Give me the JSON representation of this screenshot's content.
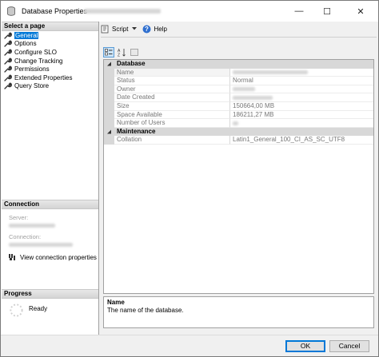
{
  "window": {
    "title": "Database Properties - ",
    "minimize": "—",
    "maximize": "☐",
    "close": "✕"
  },
  "left_pane": {
    "select_header": "Select a page",
    "pages": [
      "General",
      "Options",
      "Configure SLO",
      "Change Tracking",
      "Permissions",
      "Extended Properties",
      "Query Store"
    ],
    "connection_header": "Connection",
    "server_label": "Server:",
    "connection_label": "Connection:",
    "view_connection_link": "View connection properties",
    "progress_header": "Progress",
    "progress_status": "Ready"
  },
  "toolbar": {
    "script_label": "Script",
    "help_label": "Help"
  },
  "property_grid": {
    "categories": [
      {
        "name": "Database",
        "rows": [
          {
            "name": "Name",
            "value": ""
          },
          {
            "name": "Status",
            "value": "Normal"
          },
          {
            "name": "Owner",
            "value": ""
          },
          {
            "name": "Date Created",
            "value": ""
          },
          {
            "name": "Size",
            "value": "150664,00 MB"
          },
          {
            "name": "Space Available",
            "value": "186211,27 MB"
          },
          {
            "name": "Number of Users",
            "value": ""
          }
        ]
      },
      {
        "name": "Maintenance",
        "rows": [
          {
            "name": "Collation",
            "value": "Latin1_General_100_CI_AS_SC_UTF8"
          }
        ]
      }
    ]
  },
  "description": {
    "title": "Name",
    "text": "The name of the database."
  },
  "buttons": {
    "ok": "OK",
    "cancel": "Cancel"
  },
  "colors": {
    "accent": "#0078d7",
    "category_bg": "#d8d8d8"
  }
}
